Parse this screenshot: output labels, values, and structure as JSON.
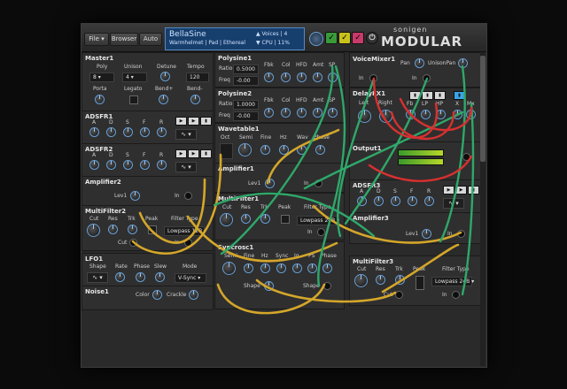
{
  "toolbar": {
    "file_label": "File",
    "browser_label": "Browser",
    "auto_label": "Auto",
    "preset_name": "BellaSine",
    "preset_meta": "Warmhelmet | Pad | Ethereal",
    "voices": "▲ Voices | 4",
    "cpu": "▼ CPU  | 11%",
    "check_glyph": "✓",
    "check_colors": [
      "#3a9a3a",
      "#c8c21c",
      "#c83a6a"
    ],
    "brand_top": "sonigen",
    "brand_main": "MODULAR"
  },
  "master": {
    "title": "Master1",
    "poly": "Poly",
    "poly_value": "8",
    "unison": "Unison",
    "unison_value": "4",
    "detune": "Detune",
    "tempo": "Tempo",
    "tempo_value": "120",
    "porta": "Porta",
    "legato": "Legato",
    "bendp": "Bend+",
    "bendm": "Bend-"
  },
  "adsr1": {
    "title": "ADSFR1",
    "a": "A",
    "d": "D",
    "s": "S",
    "f": "F",
    "r": "R"
  },
  "adsr2": {
    "title": "ADSFR2",
    "a": "A",
    "d": "D",
    "s": "S",
    "f": "F",
    "r": "R"
  },
  "amp2": {
    "title": "Amplifier2",
    "lev": "Lev1",
    "in": "In"
  },
  "mf2": {
    "title": "MultiFilter2",
    "cut": "Cut",
    "res": "Res",
    "trk": "Trk",
    "peak": "Peak",
    "ftype": "Filter Type",
    "ftype_value": "Lowpass 12B",
    "cut_jack": "Cut",
    "in": "In"
  },
  "lfo": {
    "title": "LFO1",
    "shape": "Shape",
    "rate": "Rate",
    "phase": "Phase",
    "slew": "Slew",
    "mode": "Mode",
    "mode_value": "V-Sync",
    "wave": "∿"
  },
  "noise": {
    "title": "Noise1",
    "color": "Color",
    "crackle": "Crackle"
  },
  "poly1": {
    "title": "Polysine1",
    "ratio": "Ratio",
    "ratio_value": "0.5000",
    "freq": "Freq",
    "freq_value": "-0.00",
    "fbk": "Fbk",
    "col": "Col",
    "hfd": "HFD",
    "amt": "Amt",
    "sp": "SP"
  },
  "poly2": {
    "title": "Polysine2",
    "ratio": "Ratio",
    "ratio_value": "1.0000",
    "freq": "Freq",
    "freq_value": "-0.00",
    "fbk": "Fbk",
    "col": "Col",
    "hfd": "HFD",
    "amt": "Amt",
    "sp": "SP"
  },
  "wt": {
    "title": "Wavetable1",
    "oct": "Oct",
    "semi": "Semi",
    "fine": "Fine",
    "hz": "Hz",
    "wav": "Wav",
    "phase": "Phase"
  },
  "amp1": {
    "title": "Amplifier1",
    "lev": "Lev1",
    "in": "In"
  },
  "mf1": {
    "title": "MultiFilter1",
    "cut": "Cut",
    "res": "Res",
    "trk": "Trk",
    "peak": "Peak",
    "ftype": "Filter Type",
    "ftype_value": "Lowpass 24B",
    "in": "In"
  },
  "sync": {
    "title": "Syncrosc1",
    "semi": "Semi",
    "fine": "Fine",
    "hz": "Hz",
    "sync": "Sync",
    "ig": "Ig",
    "ps": "PS",
    "phase": "Phase",
    "shape": "Shape",
    "shape2": "Shape"
  },
  "vm": {
    "title": "VoiceMixer1",
    "pan": "Pan",
    "unisonpan": "UnisonPan",
    "in1": "In",
    "in2": "In"
  },
  "delay": {
    "title": "DelayFX1",
    "left": "Left",
    "right": "Right",
    "fb": "Fb",
    "lp": "LP",
    "hp": "HP",
    "x": "X",
    "mx": "Mx"
  },
  "out": {
    "title": "Output1"
  },
  "adsr3": {
    "title": "ADSFR3",
    "a": "A",
    "d": "D",
    "s": "S",
    "f": "F",
    "r": "R"
  },
  "amp3": {
    "title": "Amplifier3",
    "lev": "Lev1",
    "in": "In"
  },
  "mf3": {
    "title": "MultiFilter3",
    "cut": "Cut",
    "res": "Res",
    "trk": "Trk",
    "peak": "Peak",
    "ftype": "Filter Type",
    "ftype_value": "Lowpass 24B",
    "cut_jack": "Cut",
    "in": "In"
  },
  "colors": {
    "cable_yellow": "#d4a62a",
    "cable_green": "#2fa86a",
    "cable_red": "#d83030",
    "knob_ring": "#69a0d8"
  }
}
